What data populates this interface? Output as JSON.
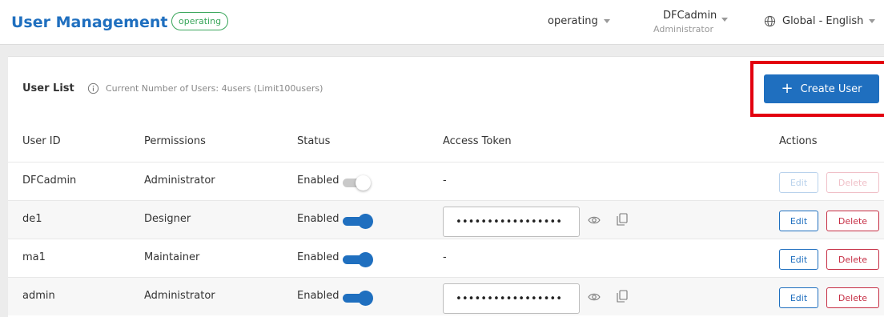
{
  "header": {
    "title": "User Management",
    "env_badge": "operating",
    "env_dropdown": "operating",
    "user_name": "DFCadmin",
    "user_role": "Administrator",
    "language": "Global - English"
  },
  "user_list": {
    "title": "User List",
    "meta": "Current Number of Users: 4users (Limit100users)",
    "create_button": "Create User"
  },
  "columns": {
    "user_id": "User ID",
    "permissions": "Permissions",
    "status": "Status",
    "access_token": "Access Token",
    "actions": "Actions"
  },
  "rows": [
    {
      "user_id": "DFCadmin",
      "permissions": "Administrator",
      "status": "Enabled",
      "toggle_on": false,
      "token": "-",
      "edit": "Edit",
      "delete": "Delete",
      "actions_disabled": true
    },
    {
      "user_id": "de1",
      "permissions": "Designer",
      "status": "Enabled",
      "toggle_on": true,
      "token": "•••••••••••••••••",
      "edit": "Edit",
      "delete": "Delete",
      "actions_disabled": false
    },
    {
      "user_id": "ma1",
      "permissions": "Maintainer",
      "status": "Enabled",
      "toggle_on": true,
      "token": "-",
      "edit": "Edit",
      "delete": "Delete",
      "actions_disabled": false
    },
    {
      "user_id": "admin",
      "permissions": "Administrator",
      "status": "Enabled",
      "toggle_on": true,
      "token": "•••••••••••••••••",
      "edit": "Edit",
      "delete": "Delete",
      "actions_disabled": false
    }
  ],
  "colors": {
    "primary": "#1f6fbf",
    "danger": "#c62e44",
    "badge": "#3aa65b",
    "highlight": "#e3000f"
  },
  "icons": {
    "info": "info-icon",
    "globe": "globe-icon",
    "eye": "eye-icon",
    "copy": "copy-icon",
    "caret": "chevron-down-icon"
  }
}
